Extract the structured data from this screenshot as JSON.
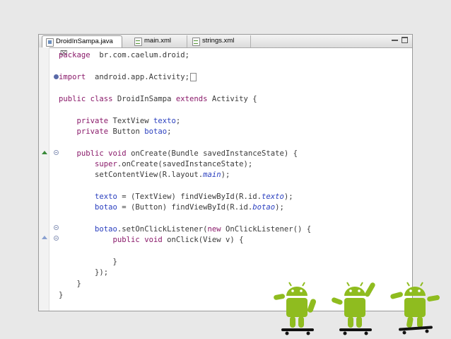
{
  "editor": {
    "tabs": [
      {
        "label": "DroidInSampa.java",
        "close": "⌧",
        "type": "java"
      },
      {
        "label": "main.xml",
        "type": "xml"
      },
      {
        "label": "strings.xml",
        "type": "xml"
      }
    ]
  },
  "code": [
    {
      "parts": [
        [
          "kw",
          "package"
        ],
        [
          "",
          "  br.com.caelum.droid;"
        ]
      ]
    },
    {
      "parts": [
        [
          "kw",
          "import"
        ],
        [
          "",
          "  android.app.Activity;"
        ]
      ]
    },
    {
      "parts": [
        [
          "kw",
          "public class"
        ],
        [
          "",
          " DroidInSampa "
        ],
        [
          "kw",
          "extends"
        ],
        [
          "",
          " Activity {"
        ]
      ]
    },
    {
      "parts": [
        [
          "",
          "    "
        ],
        [
          "kw",
          "private"
        ],
        [
          "",
          " TextView "
        ],
        [
          "fld",
          "texto"
        ],
        [
          "",
          ";"
        ]
      ]
    },
    {
      "parts": [
        [
          "",
          "    "
        ],
        [
          "kw",
          "private"
        ],
        [
          "",
          " Button "
        ],
        [
          "fld",
          "botao"
        ],
        [
          "",
          ";"
        ]
      ]
    },
    {
      "parts": [
        [
          "",
          "    "
        ],
        [
          "kw",
          "public void"
        ],
        [
          "",
          " onCreate(Bundle savedInstanceState) {"
        ]
      ]
    },
    {
      "parts": [
        [
          "",
          "        "
        ],
        [
          "kw",
          "super"
        ],
        [
          "",
          ".onCreate(savedInstanceState);"
        ]
      ]
    },
    {
      "parts": [
        [
          "",
          "        setContentView(R.layout."
        ],
        [
          "fld ital",
          "main"
        ],
        [
          "",
          ");"
        ]
      ]
    },
    {
      "parts": [
        [
          "",
          "        "
        ],
        [
          "fld",
          "texto"
        ],
        [
          "",
          " = (TextView) findViewById(R.id."
        ],
        [
          "fld ital",
          "texto"
        ],
        [
          "",
          ");"
        ]
      ]
    },
    {
      "parts": [
        [
          "",
          "        "
        ],
        [
          "fld",
          "botao"
        ],
        [
          "",
          " = (Button) findViewById(R.id."
        ],
        [
          "fld ital",
          "botao"
        ],
        [
          "",
          ");"
        ]
      ]
    },
    {
      "parts": [
        [
          "",
          "        "
        ],
        [
          "fld",
          "botao"
        ],
        [
          "",
          ".setOnClickListener("
        ],
        [
          "kw",
          "new"
        ],
        [
          "",
          " OnClickListener() {"
        ]
      ]
    },
    {
      "parts": [
        [
          "",
          "            "
        ],
        [
          "kw",
          "public void"
        ],
        [
          "",
          " onClick(View v) {"
        ]
      ]
    },
    {
      "parts": [
        [
          "",
          "            }"
        ]
      ]
    },
    {
      "parts": [
        [
          "",
          "        });"
        ]
      ]
    },
    {
      "parts": [
        [
          "",
          "    }"
        ]
      ]
    },
    {
      "parts": [
        [
          "",
          "}"
        ]
      ]
    }
  ],
  "colors": {
    "keyword": "#8a1a6a",
    "field": "#2a3fbf",
    "android": "#8fbc1f"
  },
  "decor": {
    "droids": [
      "android-skater-icon",
      "android-skater-icon",
      "android-skater-icon"
    ]
  }
}
